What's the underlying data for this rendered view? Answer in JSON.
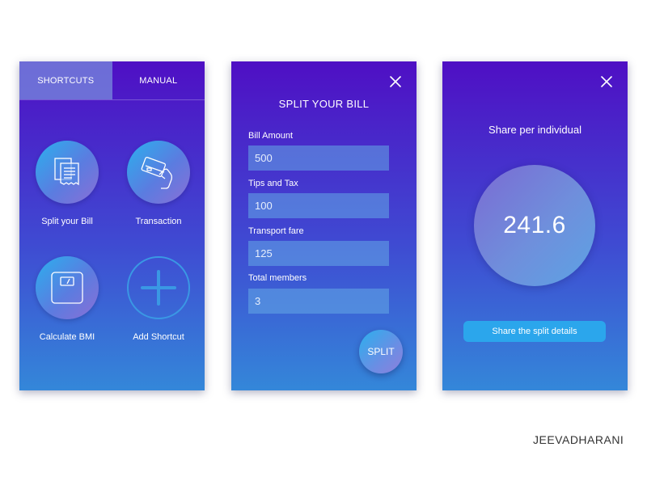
{
  "screen1": {
    "tabs": [
      {
        "label": "SHORTCUTS",
        "active": true
      },
      {
        "label": "MANUAL",
        "active": false
      }
    ],
    "shortcuts": [
      {
        "label": "Split your Bill",
        "icon": "receipt-icon"
      },
      {
        "label": "Transaction",
        "icon": "card-in-hand-icon"
      },
      {
        "label": "Calculate BMI",
        "icon": "scale-icon"
      },
      {
        "label": "Add Shortcut",
        "icon": "plus-icon"
      }
    ]
  },
  "screen2": {
    "title": "SPLIT YOUR BILL",
    "close_icon": "close-icon",
    "fields": [
      {
        "label": "Bill Amount",
        "value": "500"
      },
      {
        "label": "Tips and Tax",
        "value": "100"
      },
      {
        "label": "Transport fare",
        "value": "125"
      },
      {
        "label": "Total members",
        "value": "3"
      }
    ],
    "split_label": "SPLIT"
  },
  "screen3": {
    "title": "Share per individual",
    "close_icon": "close-icon",
    "share_value": "241.6",
    "share_button_label": "Share the split details"
  },
  "credit": "JEEVADHARANI",
  "colors": {
    "gradient_top": "#4f0fc4",
    "gradient_bottom": "#3487d9",
    "accent": "#2ba6ec"
  }
}
